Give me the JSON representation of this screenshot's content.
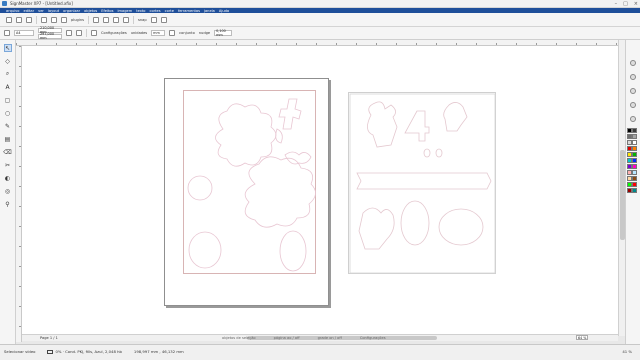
{
  "window": {
    "title": "SignMaster XP7 - [Untitled.xfix]"
  },
  "menu": [
    "arquivo",
    "editar",
    "ver",
    "layout",
    "organizar",
    "objetos",
    "Efeitos",
    "imagem",
    "texto",
    "cortes",
    "corte",
    "ferramentas",
    "janela",
    "Ajuda"
  ],
  "toolbar": {
    "zoom_value": "plugins",
    "extra_label": "snap"
  },
  "props": {
    "font_value": "A4",
    "width_value": "210,000 mm",
    "height_value": "297,000 mm",
    "config_label": "Configurações",
    "units_label": "unidades",
    "units_value": "mm",
    "together_label": "conjunto",
    "nudge_label": "nudge",
    "nudge_value": "0,100 mm"
  },
  "bottom": {
    "page_label": "Page 1 / 1",
    "snap_items": [
      "objetos de seleção",
      "página ao / off",
      "grade on / off",
      "Configurações"
    ],
    "zoom_value": "64 %"
  },
  "status": {
    "left_label": "Selecionar vídeo",
    "info": "0% · Cond. PKJ, fills, Azul, 2,048 hb",
    "coords": "198,997 mm , 46,132 mm",
    "right_value": "41 %"
  },
  "palette": [
    "#000000",
    "#3b3b3b",
    "#6e6e6e",
    "#a3a3a3",
    "#d8d8d8",
    "#ffffff",
    "#e00000",
    "#ff7f00",
    "#ffe600",
    "#00b400",
    "#00c8c8",
    "#0028ff",
    "#7a00d6",
    "#ff00c8",
    "#ffb0b0",
    "#b9e6ff",
    "#ffd9a6",
    "#8a4b14",
    "#00ff00",
    "#ff0000",
    "#9a0000",
    "#008a8a"
  ]
}
